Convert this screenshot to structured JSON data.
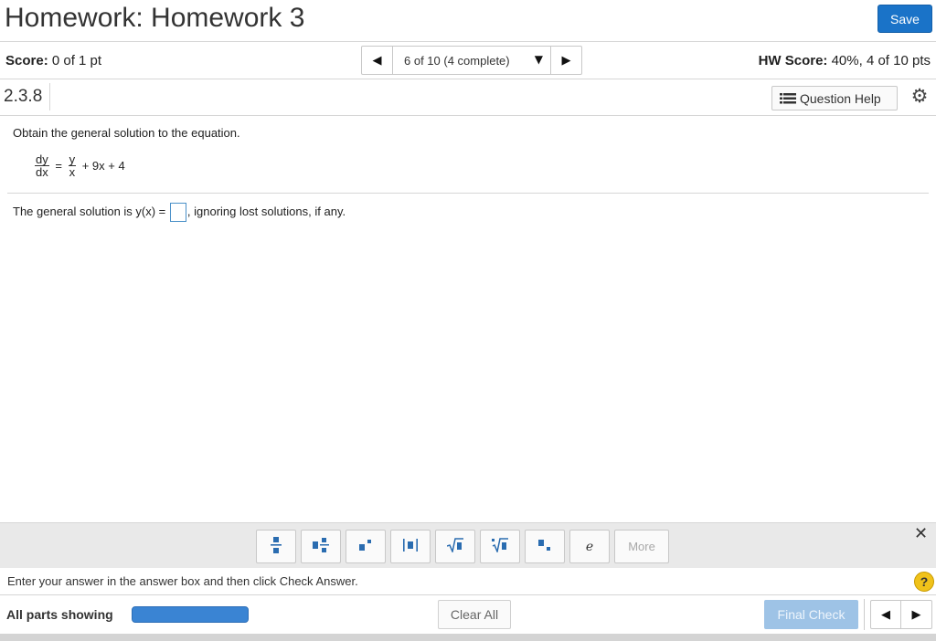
{
  "header": {
    "title": "Homework: Homework 3",
    "save_label": "Save"
  },
  "score_bar": {
    "score_label": "Score:",
    "score_value": " 0 of 1 pt",
    "nav_prev_icon": "◀",
    "nav_position": "6 of 10 (4 complete)",
    "nav_caret": "▼",
    "nav_next_icon": "▶",
    "hw_score_label": "HW Score:",
    "hw_score_value": " 40%, 4 of 10 pts"
  },
  "question": {
    "number": "2.3.8",
    "help_label": "Question Help",
    "gear_icon": "⚙",
    "prompt": "Obtain the general solution to the equation.",
    "equation": {
      "lhs_num": "dy",
      "lhs_den": "dx",
      "equals": "=",
      "rhs_num": "y",
      "rhs_den": "x",
      "rhs_rest": "+ 9x + 4"
    },
    "answer_prefix": "The general solution is y(x) =",
    "answer_suffix": ", ignoring lost solutions, if any.",
    "answer_value": ""
  },
  "palette": {
    "buttons": [
      "fraction",
      "mixed-number",
      "exponent",
      "absolute-value",
      "square-root",
      "nth-root",
      "subscript",
      "e",
      "More"
    ],
    "e_label": "e",
    "more_label": "More",
    "close_icon": "✕"
  },
  "instruction": {
    "text": "Enter your answer in the answer box and then click Check Answer.",
    "help_icon": "?"
  },
  "footer": {
    "parts_label": "All parts showing",
    "progress": 1.0,
    "clear_label": "Clear All",
    "final_label": "Final Check",
    "prev_icon": "◀",
    "next_icon": "▶"
  },
  "colors": {
    "accent": "#1a73c8",
    "progress": "#3a84d3",
    "final_disabled": "#9ec3e6",
    "help_yellow": "#f0c21a"
  }
}
